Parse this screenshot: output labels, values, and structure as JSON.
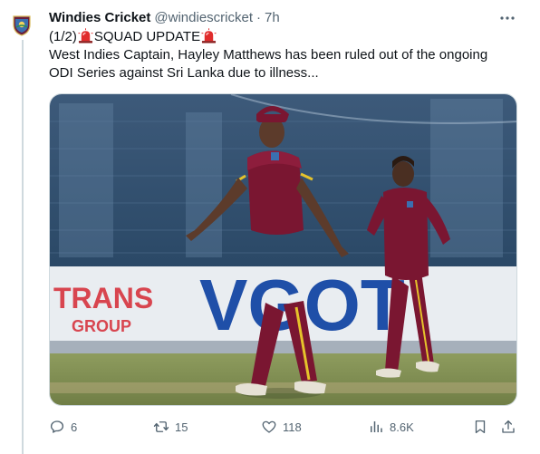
{
  "tweet": {
    "author_name": "Windies Cricket",
    "author_handle": "@windiescricket",
    "separator": "·",
    "time_ago": "7h",
    "avatar_icon": "windies-crest-icon",
    "text_prefix": "(1/2)",
    "text_headline": "SQUAD UPDATE",
    "siren_icon": "rotating-light-emoji",
    "text_body_line1": "West Indies Captain, Hayley Matthews has been ruled out of the ongoing",
    "text_body_line2": "ODI Series against Sri Lanka due to illness...",
    "media": {
      "description_icon": "cricket-photo",
      "board_left_line1": "TRANS",
      "board_left_line2": "GROUP",
      "board_right": "VGOT"
    }
  },
  "actions": {
    "reply_count": "6",
    "retweet_count": "15",
    "like_count": "118",
    "views_count": "8.6K",
    "icons": [
      "reply-icon",
      "retweet-icon",
      "like-icon",
      "views-icon",
      "bookmark-icon",
      "share-icon"
    ]
  },
  "colors": {
    "text_primary": "#0f1419",
    "text_secondary": "#536471",
    "border": "#cfd9de",
    "maroon": "#7a1631",
    "siren_red": "#e0245e"
  }
}
